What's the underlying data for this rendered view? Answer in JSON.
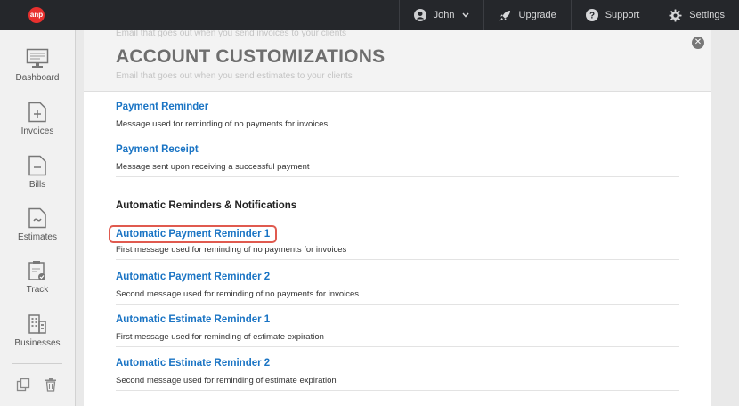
{
  "app": {
    "logo_text": "anp",
    "brand_color": "#e8302e"
  },
  "topnav": [
    {
      "label": "John",
      "icon": "user-icon"
    },
    {
      "label": "Upgrade",
      "icon": "rocket-icon"
    },
    {
      "label": "Support",
      "icon": "help-icon"
    },
    {
      "label": "Settings",
      "icon": "gear-icon"
    }
  ],
  "sidebar": {
    "items": [
      {
        "label": "Dashboard",
        "icon": "monitor-icon"
      },
      {
        "label": "Invoices",
        "icon": "invoice-icon"
      },
      {
        "label": "Bills",
        "icon": "bill-icon"
      },
      {
        "label": "Estimates",
        "icon": "estimate-icon"
      },
      {
        "label": "Track",
        "icon": "clipboard-icon"
      },
      {
        "label": "Businesses",
        "icon": "building-icon"
      }
    ]
  },
  "panel": {
    "title": "ACCOUNT CUSTOMIZATIONS",
    "ghost_top": "Email that goes out when you send invoices to your clients",
    "ghost_bottom": "Email that goes out when you send estimates to your clients",
    "items": [
      {
        "title": "Payment Reminder",
        "desc": "Message used for reminding of no payments for invoices"
      },
      {
        "title": "Payment Receipt",
        "desc": "Message sent upon receiving a successful payment"
      }
    ],
    "section_title": "Automatic Reminders & Notifications",
    "auto_items": [
      {
        "title": "Automatic Payment Reminder 1",
        "desc": "First message used for reminding of no payments for invoices",
        "highlighted": true
      },
      {
        "title": "Automatic Payment Reminder 2",
        "desc": "Second message used for reminding of no payments for invoices"
      },
      {
        "title": "Automatic Estimate Reminder 1",
        "desc": "First message used for reminding of estimate expiration"
      },
      {
        "title": "Automatic Estimate Reminder 2",
        "desc": "Second message used for reminding of estimate expiration"
      }
    ]
  },
  "colors": {
    "link": "#1a74c4",
    "topbar": "#25272b",
    "highlight": "#e05a4f"
  }
}
